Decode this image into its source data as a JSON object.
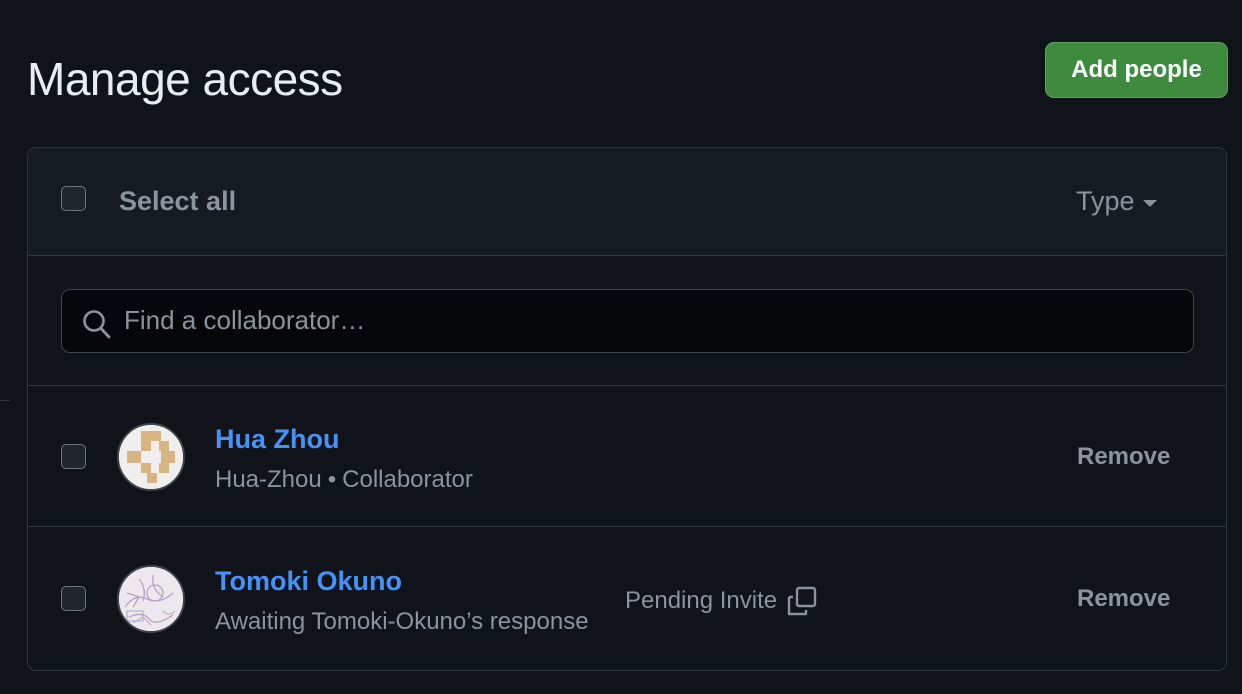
{
  "page": {
    "title": "Manage access",
    "add_button": "Add people"
  },
  "panel": {
    "select_all": "Select all",
    "type_filter": "Type",
    "search_placeholder": "Find a collaborator…"
  },
  "members": [
    {
      "name": "Hua Zhou",
      "username": "Hua-Zhou",
      "separator": "•",
      "role": "Collaborator",
      "action": "Remove"
    },
    {
      "name": "Tomoki Okuno",
      "subtitle": "Awaiting Tomoki-Okuno’s response",
      "status": "Pending Invite",
      "action": "Remove"
    }
  ],
  "colors": {
    "background": "#10131a",
    "header_bg": "#161b22",
    "border": "#30363d",
    "link": "#4493f8",
    "muted": "#8b949e",
    "primary_button": "#3f8b3e"
  },
  "icons": [
    "search-icon",
    "caret-down-icon",
    "copy-icon"
  ]
}
